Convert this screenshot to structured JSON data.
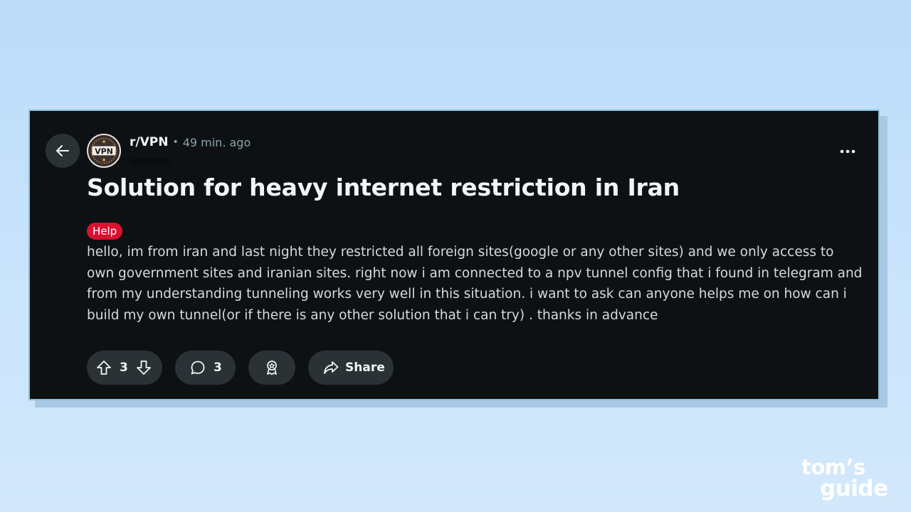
{
  "post": {
    "subreddit": "r/VPN",
    "separator": "•",
    "time_ago": "49 min. ago",
    "title": "Solution for heavy internet restriction in Iran",
    "flair": "Help",
    "body": "hello, im from iran and last night they restricted all foreign sites(google or any other sites) and we only access to own government sites and iranian sites. right now i am connected to a npv tunnel config that i found in telegram and from my understanding tunneling works very well in this situation. i want to ask can anyone helps me on how can i build my own tunnel(or if there is any other solution that i can try) . thanks in advance",
    "avatar_text": "VPN"
  },
  "actions": {
    "vote_count": "3",
    "comment_count": "3",
    "share_label": "Share"
  },
  "icons": {
    "back": "arrow-left-icon",
    "more": "ellipsis-icon",
    "upvote": "arrow-up-icon",
    "downvote": "arrow-down-icon",
    "comment": "speech-bubble-icon",
    "award": "award-ribbon-icon",
    "share": "share-arrow-icon"
  },
  "watermark": {
    "line1": "tom’s",
    "line2": "guide"
  },
  "colors": {
    "card_bg": "#0e1113",
    "pill_bg": "#2a3236",
    "flair_bg": "#d8112f",
    "meta_text": "#8ba2ad",
    "page_bg": "#c8e3fb"
  }
}
